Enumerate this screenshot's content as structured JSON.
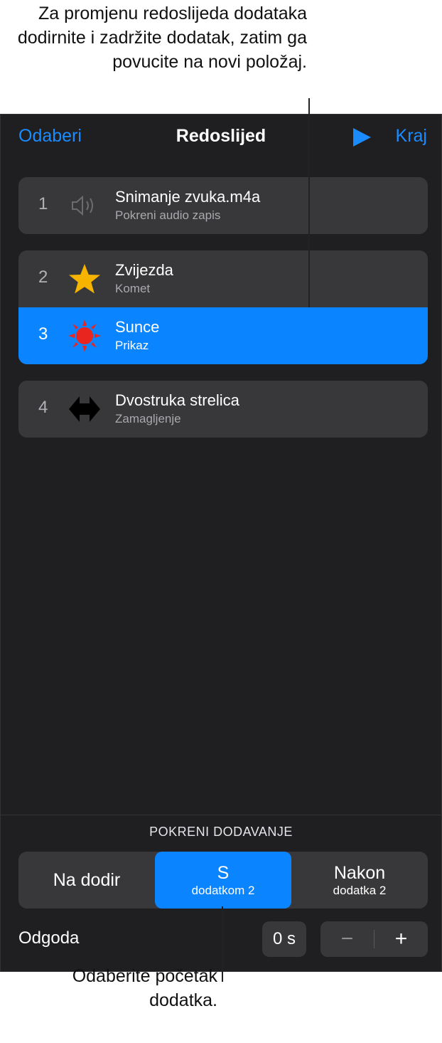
{
  "callouts": {
    "top": "Za promjenu redoslijeda dodataka dodirnite i zadržite dodatak, zatim ga povucite na novi položaj.",
    "bottom": "Odaberite početak dodatka."
  },
  "header": {
    "select_label": "Odaberi",
    "title": "Redoslijed",
    "done_label": "Kraj",
    "play_icon": "play-icon",
    "accent_color": "#1a8cff"
  },
  "builds": [
    {
      "number": "1",
      "name": "Snimanje zvuka.m4a",
      "effect": "Pokreni audio zapis",
      "icon": "speaker-icon"
    },
    {
      "number": "2",
      "name": "Zvijezda",
      "effect": "Komet",
      "icon": "star-icon"
    },
    {
      "number": "3",
      "name": "Sunce",
      "effect": "Prikaz",
      "icon": "sun-icon",
      "selected": true
    },
    {
      "number": "4",
      "name": "Dvostruka strelica",
      "effect": "Zamagljenje",
      "icon": "double-arrow-icon"
    }
  ],
  "start_build": {
    "label": "POKRENI DODAVANJE",
    "options": [
      {
        "main": "Na dodir",
        "sub": ""
      },
      {
        "main": "S",
        "sub": "dodatkom 2",
        "selected": true
      },
      {
        "main": "Nakon",
        "sub": "dodatka 2"
      }
    ]
  },
  "delay": {
    "label": "Odgoda",
    "value": "0 s",
    "decrement": "−",
    "increment": "+"
  }
}
